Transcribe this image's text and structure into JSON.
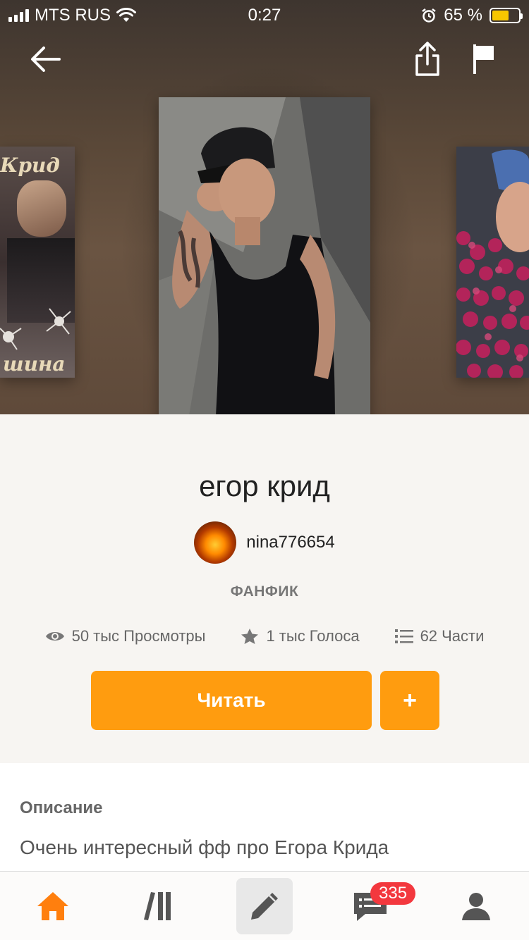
{
  "status_bar": {
    "carrier": "MTS RUS",
    "time": "0:27",
    "battery": "65 %",
    "battery_level": 0.65,
    "battery_color": "#f7c600"
  },
  "toolbar": {
    "back_icon": "arrow-left-icon",
    "share_icon": "share-icon",
    "flag_icon": "flag-icon"
  },
  "covers": {
    "left_text_top": "Крид",
    "left_text_bottom": "шина"
  },
  "story": {
    "title": "егор крид",
    "author": "nina776654",
    "genre": "ФАНФИК",
    "stats": {
      "views": "50 тыс Просмотры",
      "votes": "1 тыс Голоса",
      "parts": "62 Части"
    },
    "read_label": "Читать",
    "add_label": "+"
  },
  "description": {
    "heading": "Описание",
    "text": "Очень интересный фф про Егора Крида"
  },
  "bottom_nav": {
    "items": [
      "home-icon",
      "library-icon",
      "write-icon",
      "messages-icon",
      "profile-icon"
    ],
    "messages_badge": "335"
  },
  "colors": {
    "accent": "#ff9c0f",
    "badge": "#f3383e",
    "active_nav": "#ff7f0e"
  }
}
